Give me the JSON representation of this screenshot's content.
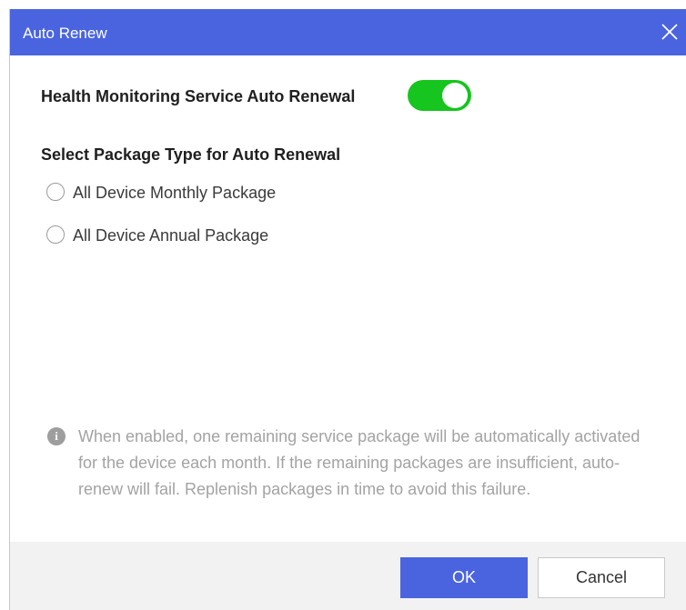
{
  "dialog": {
    "title": "Auto Renew",
    "close_icon": "close-icon"
  },
  "auto_renewal": {
    "label": "Health Monitoring Service Auto Renewal",
    "enabled": true,
    "on_color": "#16c51e"
  },
  "package_type": {
    "heading": "Select Package Type for Auto Renewal",
    "options": [
      {
        "label": "All Device Monthly Package",
        "selected": false
      },
      {
        "label": "All Device Annual Package",
        "selected": false
      }
    ]
  },
  "info": {
    "icon": "info-icon",
    "icon_glyph": "i",
    "text": "When enabled, one remaining service package will be automatically activated for the device each month. If the remaining packages are insufficient, auto-renew will fail. Replenish packages in time to avoid this failure."
  },
  "footer": {
    "ok_label": "OK",
    "cancel_label": "Cancel"
  },
  "colors": {
    "accent": "#4a64e0",
    "footer_bg": "#f2f2f2",
    "hint_text": "#a3a3a3"
  }
}
